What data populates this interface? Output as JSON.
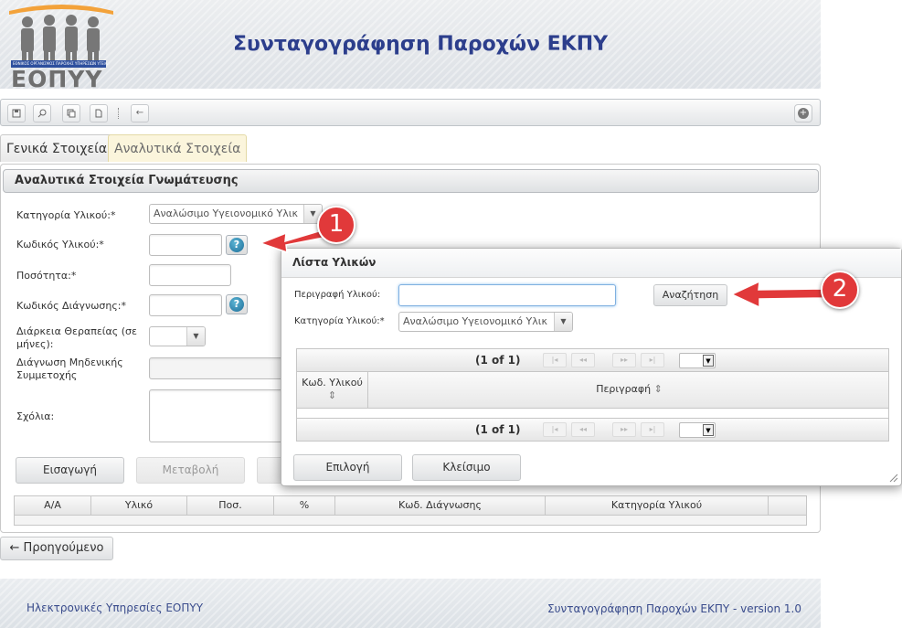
{
  "header": {
    "app_title": "Συνταγογράφηση Παροχών ΕΚΠΥ",
    "logo_text": "ΕΟΠΥΥ",
    "logo_subtext": "ΕΘΝΙΚΟΣ ΟΡΓΑΝΙΣΜΟΣ ΠΑΡΟΧΗΣ ΥΠΗΡΕΣΙΩΝ ΥΓΕΙΑΣ"
  },
  "toolbar": {
    "icons": [
      "save-icon",
      "search-icon",
      "copy-icon",
      "new-document-icon",
      "back-arrow-icon",
      "add-circle-icon"
    ],
    "back_glyph": "←",
    "add_glyph": "+"
  },
  "tabs": [
    {
      "label": "Γενικά Στοιχεία",
      "active": false
    },
    {
      "label": "Αναλυτικά Στοιχεία",
      "active": true
    }
  ],
  "panel": {
    "title": "Αναλυτικά Στοιχεία Γνωμάτευσης",
    "fields": {
      "category_label": "Κατηγορία Υλικού:*",
      "category_value": "Αναλώσιμο Υγειονομικό Υλικ",
      "code_label": "Κωδικός Υλικού:*",
      "quantity_label": "Ποσότητα:*",
      "diagnosis_label": "Κωδικός Διάγνωσης:*",
      "duration_label": "Διάρκεια Θεραπείας (σε μήνες):",
      "zero_diagnosis_label": "Διάγνωση Μηδενικής Συμμετοχής",
      "comments_label": "Σχόλια:"
    },
    "buttons": {
      "insert": "Εισαγωγή",
      "modify": "Μεταβολή"
    },
    "grid_columns": [
      "Α/Α",
      "Υλικό",
      "Ποσ.",
      "%",
      "Κωδ. Διάγνωσης",
      "Κατηγορία Υλικού"
    ]
  },
  "previous_button": "← Προηγούμενο",
  "footer": {
    "left": "Ηλεκτρονικές Υπηρεσίες ΕΟΠΥΥ",
    "right": "Συνταγογράφηση Παροχών ΕΚΠΥ - version 1.0"
  },
  "dialog": {
    "title": "Λίστα Υλικών",
    "description_label": "Περιγραφή Υλικού:",
    "description_value": "",
    "category_label": "Κατηγορία Υλικού:*",
    "category_value": "Αναλώσιμο Υγειονομικό Υλικ",
    "search_button": "Αναζήτηση",
    "pager_text": "(1 of 1)",
    "pager_glyphs": [
      "|◂",
      "◂◂",
      "▸▸",
      "▸|"
    ],
    "col_code": "Κωδ. Υλικού",
    "col_description": "Περιγραφή",
    "sort_glyph": "⇕",
    "select_button": "Επιλογή",
    "close_button": "Κλείσιμο"
  },
  "annotations": {
    "marker_1": "1",
    "marker_2": "2",
    "color": "#e1393a"
  },
  "colors": {
    "title_blue": "#2c3e8c",
    "help_blue": "#1f6e99",
    "active_tab": "#fbf5dc"
  }
}
